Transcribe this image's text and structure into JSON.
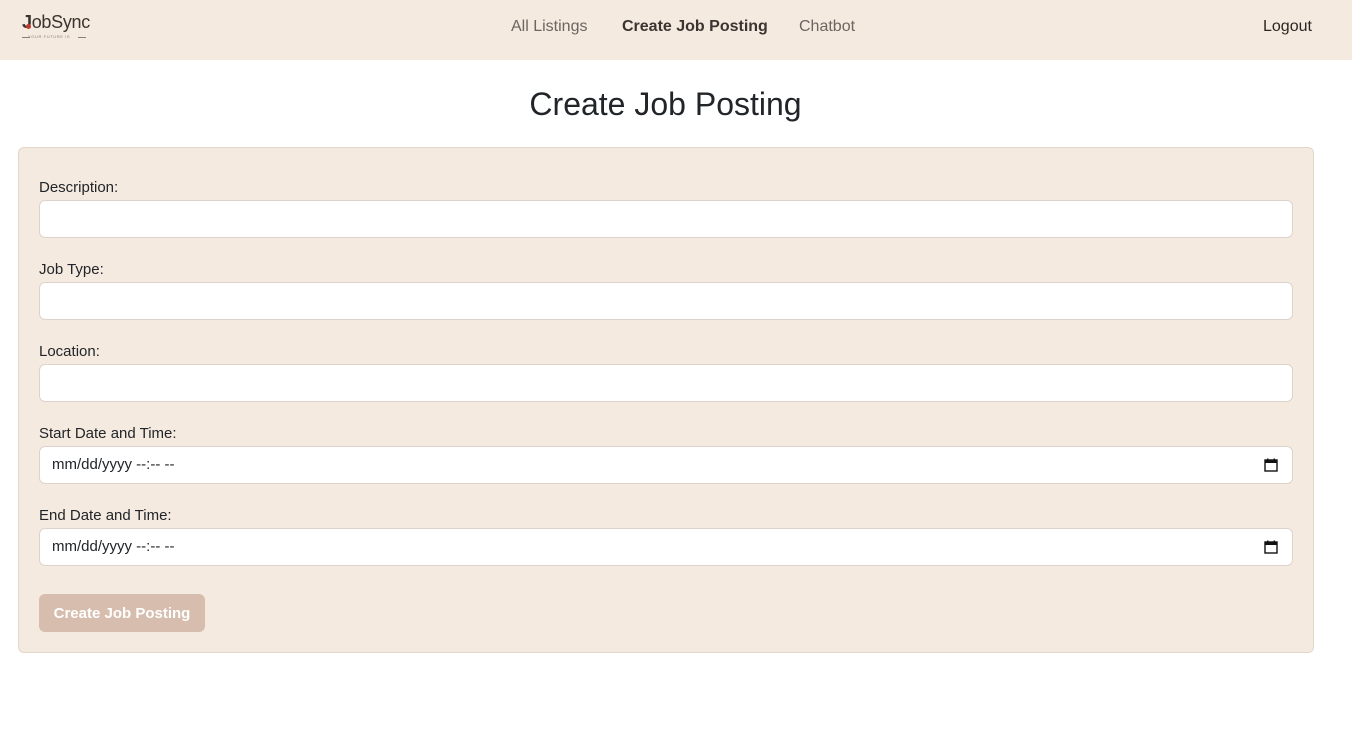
{
  "brand": {
    "name": "JobSync",
    "tagline": "YOUR FUTURE IS"
  },
  "nav": {
    "links": [
      {
        "label": "All Listings",
        "active": false
      },
      {
        "label": "Create Job Posting",
        "active": true
      },
      {
        "label": "Chatbot",
        "active": false
      }
    ],
    "logout": "Logout"
  },
  "page": {
    "title": "Create Job Posting"
  },
  "form": {
    "description": {
      "label": "Description:",
      "value": ""
    },
    "job_type": {
      "label": "Job Type:",
      "value": ""
    },
    "location": {
      "label": "Location:",
      "value": ""
    },
    "start": {
      "label": "Start Date and Time:",
      "placeholder": "mm/dd/yyyy --:-- --"
    },
    "end": {
      "label": "End Date and Time:",
      "placeholder": "mm/dd/yyyy --:-- --"
    },
    "submit_label": "Create Job Posting"
  },
  "colors": {
    "navbar_bg": "#f5eae0",
    "card_bg": "#f5eae0",
    "button_bg": "#d7bdad",
    "brand_dot": "#c0392b"
  }
}
